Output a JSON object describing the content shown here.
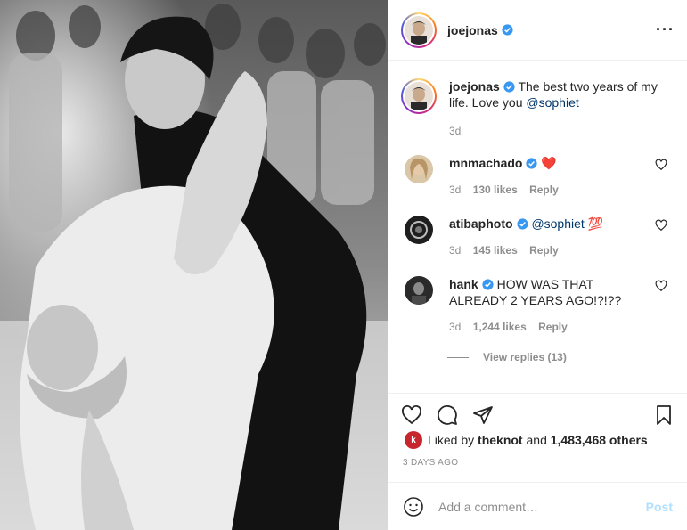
{
  "post": {
    "author": "joejonas",
    "more_icon": "more-horizontal-icon",
    "caption_text": "The best two years of my life. Love you",
    "caption_mention": "@sophiet",
    "caption_time": "3d"
  },
  "comments": [
    {
      "user": "mnmachado",
      "text": "❤️",
      "time": "3d",
      "likes": "130 likes",
      "reply": "Reply"
    },
    {
      "user": "atibaphoto",
      "text": "@sophiet 💯",
      "time": "3d",
      "likes": "145 likes",
      "reply": "Reply"
    },
    {
      "user": "hank",
      "text": "HOW WAS THAT ALREADY 2 YEARS AGO!?!??",
      "time": "3d",
      "likes": "1,244 likes",
      "reply": "Reply",
      "view_replies": "View replies (13)"
    }
  ],
  "actions": {
    "icons": [
      "heart-icon",
      "comment-icon",
      "share-icon",
      "bookmark-icon"
    ],
    "liked_prefix": "Liked by",
    "liked_user": "theknot",
    "liked_and": "and",
    "liked_others": "1,483,468 others",
    "timestamp": "3 DAYS AGO"
  },
  "add_comment": {
    "placeholder": "Add a comment…",
    "post_label": "Post"
  },
  "colors": {
    "link": "#00376b",
    "verified": "#3897f0",
    "post_disabled": "#b2dffc"
  }
}
